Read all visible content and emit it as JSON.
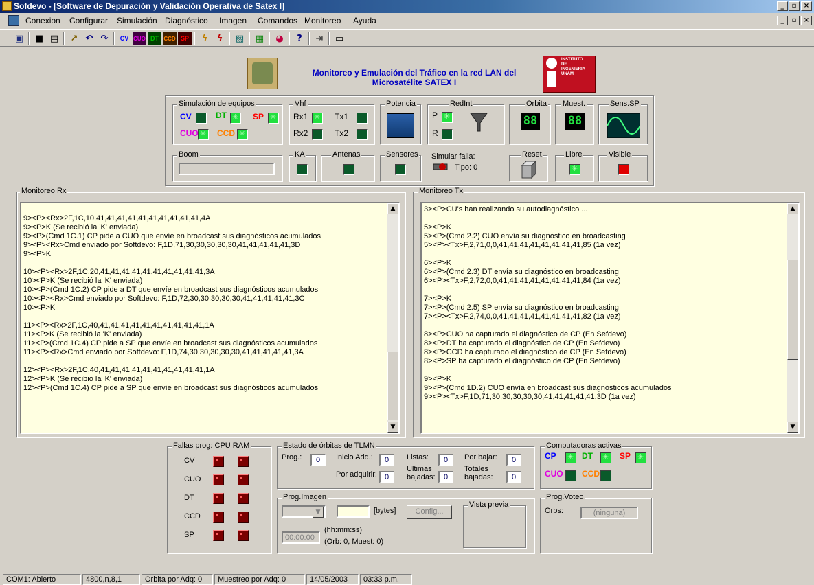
{
  "window": {
    "title": "Sofdevo - [Software de Depuración y Validación Operativa de Satex I]",
    "min_glyph": "_",
    "max_glyph": "▫",
    "close_glyph": "×"
  },
  "menu": [
    "Conexion",
    "Configurar",
    "Simulación",
    "Diagnóstico",
    "Imagen",
    "Comandos",
    "Monitoreo",
    "Ayuda"
  ],
  "toolbar": {
    "buttons": [
      {
        "icon": "connect-icon",
        "glyph": "▣"
      },
      {
        "icon": "save-icon",
        "glyph": "■"
      },
      {
        "icon": "print-icon",
        "glyph": "▤"
      },
      {
        "icon": "wand-icon",
        "glyph": "↗"
      },
      {
        "icon": "undo-icon",
        "glyph": "↶"
      },
      {
        "icon": "redo-icon",
        "glyph": "↷"
      },
      {
        "icon": "cv-icon",
        "glyph": "CV"
      },
      {
        "icon": "cuo-icon",
        "glyph": "CUO"
      },
      {
        "icon": "dt-icon",
        "glyph": "DT"
      },
      {
        "icon": "ccd-icon",
        "glyph": "CCD"
      },
      {
        "icon": "sp-icon",
        "glyph": "SP"
      },
      {
        "icon": "lightning-icon",
        "glyph": "ϟ"
      },
      {
        "icon": "lightning-multi-icon",
        "glyph": "ϟ"
      },
      {
        "icon": "image-icon",
        "glyph": "▧"
      },
      {
        "icon": "chart-icon",
        "glyph": "▦"
      },
      {
        "icon": "palette-icon",
        "glyph": "◕"
      },
      {
        "icon": "help-icon",
        "glyph": "?"
      },
      {
        "icon": "exit-icon",
        "glyph": "⇥"
      },
      {
        "icon": "window-icon",
        "glyph": "▭"
      }
    ]
  },
  "header": {
    "title": "Monitoreo y Emulación del Tráfico en la red LAN del",
    "subtitle": "Microsatélite SATEX I",
    "logo_right_lines": [
      "INSTITUTO",
      "DE",
      "INGENIERIA",
      "UNAM"
    ]
  },
  "panel": {
    "sim": {
      "label": "Simulación de equipos",
      "cv": "CV",
      "dt": "DT",
      "sp": "SP",
      "cuo": "CUO",
      "ccd": "CCD"
    },
    "vhf": {
      "label": "Vhf",
      "rx1": "Rx1",
      "tx1": "Tx1",
      "rx2": "Rx2",
      "tx2": "Tx2"
    },
    "potencia": {
      "label": "Potencia"
    },
    "redint": {
      "label": "RedInt",
      "p": "P",
      "r": "R",
      "simular": "Simular falla:",
      "tipo": "Tipo: 0"
    },
    "orbita": {
      "label": "Orbita",
      "value": "88"
    },
    "muest": {
      "label": "Muest.",
      "value": "88"
    },
    "sens": {
      "label": "Sens.SP"
    },
    "boom": {
      "label": "Boom"
    },
    "ka": {
      "label": "KA"
    },
    "antenas": {
      "label": "Antenas"
    },
    "sensores": {
      "label": "Sensores"
    },
    "reset": {
      "label": "Reset"
    },
    "libre": {
      "label": "Libre"
    },
    "visible": {
      "label": "Visible"
    }
  },
  "colors": {
    "cv": "#0000ff",
    "dt": "#00b000",
    "sp": "#ff0000",
    "cuo": "#e000e0",
    "ccd": "#ff8000",
    "cp": "#0000ff"
  },
  "rx": {
    "label": "Monitoreo Rx",
    "lines": [
      "",
      "9><P><Rx>2F,1C,10,41,41,41,41,41,41,41,41,41,41,4A",
      "9><P>K  (Se recibió la 'K' enviada)",
      "9><P>(Cmd 1C.1) CP pide a CUO que envíe en broadcast sus diagnósticos acumulados",
      "9><P><Rx>Cmd enviado por Softdevo: F,1D,71,30,30,30,30,30,41,41,41,41,41,3D",
      "9><P>K",
      "",
      "10><P><Rx>2F,1C,20,41,41,41,41,41,41,41,41,41,41,3A",
      "10><P>K  (Se recibió la 'K' enviada)",
      "10><P>(Cmd 1C.2) CP pide a DT que envíe en broadcast sus diagnósticos acumulados",
      "10><P><Rx>Cmd enviado por Softdevo: F,1D,72,30,30,30,30,30,41,41,41,41,41,3C",
      "10><P>K",
      "",
      "11><P><Rx>2F,1C,40,41,41,41,41,41,41,41,41,41,41,1A",
      "11><P>K  (Se recibió la 'K' enviada)",
      "11><P>(Cmd 1C.4) CP pide a SP que envíe en broadcast sus diagnósticos acumulados",
      "11><P><Rx>Cmd enviado por Softdevo: F,1D,74,30,30,30,30,30,41,41,41,41,41,3A",
      "",
      "12><P><Rx>2F,1C,40,41,41,41,41,41,41,41,41,41,41,1A",
      "12><P>K  (Se recibió la 'K' enviada)",
      "12><P>(Cmd 1C.4) CP pide a SP que envíe en broadcast sus diagnósticos acumulados"
    ]
  },
  "tx": {
    "label": "Monitoreo Tx",
    "lines": [
      "3><P>CU's han realizando su autodiagnóstico ...",
      "",
      "5><P>K",
      "5><P>(Cmd 2.2) CUO envía su diagnóstico en broadcasting",
      "5><P><Tx>F,2,71,0,0,41,41,41,41,41,41,41,41,85 (1a vez)",
      "",
      "6><P>K",
      "6><P>(Cmd 2.3) DT envía su diagnóstico en broadcasting",
      "6><P><Tx>F,2,72,0,0,41,41,41,41,41,41,41,41,84 (1a vez)",
      "",
      "7><P>K",
      "7><P>(Cmd 2.5) SP envía su diagnóstico en broadcasting",
      "7><P><Tx>F,2,74,0,0,41,41,41,41,41,41,41,41,82 (1a vez)",
      "",
      "8><P>CUO ha capturado el diagnóstico de CP (En Sefdevo)",
      "8><P>DT ha capturado el diagnóstico de CP (En Sefdevo)",
      "8><P>CCD ha capturado el diagnóstico de CP (En Sefdevo)",
      "8><P>SP ha capturado el diagnóstico de CP (En Sefdevo)",
      "",
      "9><P>K",
      "9><P>(Cmd 1D.2) CUO envía en broadcast sus diagnósticos acumulados",
      "9><P><Tx>F,1D,71,30,30,30,30,30,41,41,41,41,41,3D (1a vez)"
    ]
  },
  "fallas": {
    "label": "Fallas prog: CPU  RAM",
    "rows": [
      "CV",
      "CUO",
      "DT",
      "CCD",
      "SP"
    ]
  },
  "estado": {
    "label": "Estado de órbitas de TLMN",
    "prog": "Prog.:",
    "prog_v": "0",
    "inicio": "Inicio Adq.:",
    "inicio_v": "0",
    "listas": "Listas:",
    "listas_v": "0",
    "porbajar": "Por bajar:",
    "porbajar_v": "0",
    "poradq": "Por adquirir:",
    "poradq_v": "0",
    "ultimas1": "Ultimas",
    "ultimas2": "bajadas:",
    "ultimas_v": "0",
    "totales1": "Totales",
    "totales2": "bajadas:",
    "totales_v": "0"
  },
  "progimg": {
    "label": "Prog.Imagen",
    "bytes": "[bytes]",
    "config": "Config...",
    "time": "00:00:00",
    "hhmmss": "(hh:mm:ss)",
    "orbmuest": "(Orb: 0, Muest: 0)",
    "vista": "Vista previa"
  },
  "activas": {
    "label": "Computadoras activas",
    "cp": "CP",
    "dt": "DT",
    "sp": "SP",
    "cuo": "CUO",
    "ccd": "CCD"
  },
  "voteo": {
    "label": "Prog.Voteo",
    "orbs": "Orbs:",
    "value": "(ninguna)"
  },
  "status": [
    "COM1: Abierto",
    "4800,n,8,1",
    "Orbita por Adq: 0",
    "Muestreo por Adq: 0",
    "14/05/2003",
    "03:33 p.m."
  ]
}
